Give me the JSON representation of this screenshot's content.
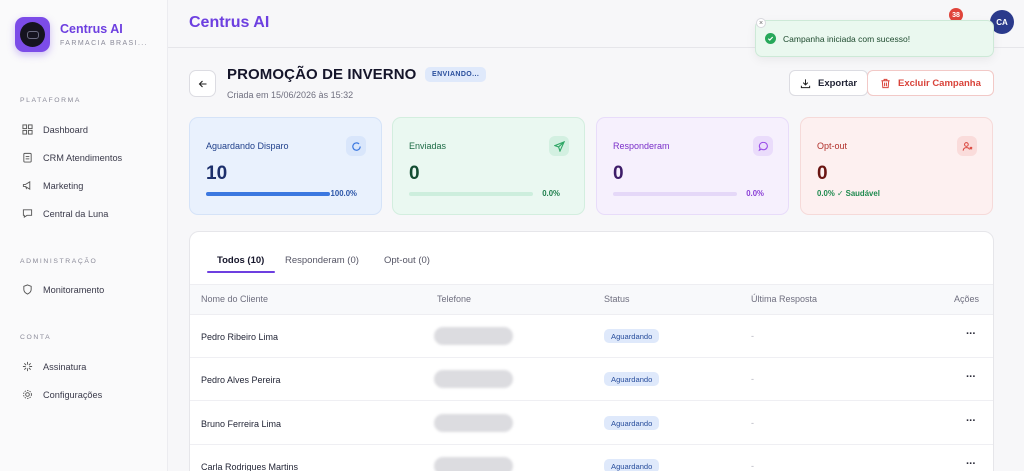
{
  "sidebar": {
    "brand_name": "Centrus AI",
    "brand_sub": "FARMACIA BRASI...",
    "sections": {
      "platform": "PLATAFORMA",
      "admin": "ADMINISTRAÇÃO",
      "account": "CONTA"
    },
    "items": {
      "dashboard": "Dashboard",
      "crm": "CRM Atendimentos",
      "marketing": "Marketing",
      "luna": "Central da Luna",
      "monitor": "Monitoramento",
      "subscription": "Assinatura",
      "settings": "Configurações"
    }
  },
  "topbar": {
    "title": "Centrus AI",
    "notification_count": "38",
    "avatar_initials": "CA"
  },
  "toast": {
    "close": "×",
    "message": "Campanha iniciada com sucesso!"
  },
  "campaign": {
    "title": "PROMOÇÃO DE INVERNO",
    "status": "ENVIANDO...",
    "created": "Criada em 15/06/2026 às 15:32",
    "export_label": "Exportar",
    "delete_label": "Excluir Campanha"
  },
  "stats": [
    {
      "label": "Aguardando Disparo",
      "value": "10",
      "percent": "100.0%",
      "fill": 1.0,
      "icon": "loading-icon"
    },
    {
      "label": "Enviadas",
      "value": "0",
      "percent": "0.0%",
      "fill": 0.0,
      "icon": "send-icon"
    },
    {
      "label": "Responderam",
      "value": "0",
      "percent": "0.0%",
      "fill": 0.0,
      "icon": "message-icon"
    },
    {
      "label": "Opt-out",
      "value": "0",
      "health": "0.0% ✓ Saudável",
      "icon": "user-remove-icon"
    }
  ],
  "tabs": [
    "Todos (10)",
    "Responderam (0)",
    "Opt-out (0)"
  ],
  "table": {
    "headers": [
      "Nome do Cliente",
      "Telefone",
      "Status",
      "Última Resposta",
      "Ações"
    ],
    "rows": [
      {
        "name": "Pedro Ribeiro Lima",
        "status": "Aguardando",
        "last": "-",
        "actions": "···"
      },
      {
        "name": "Pedro Alves Pereira",
        "status": "Aguardando",
        "last": "-",
        "actions": "···"
      },
      {
        "name": "Bruno Ferreira Lima",
        "status": "Aguardando",
        "last": "-",
        "actions": "···"
      },
      {
        "name": "Carla Rodrigues Martins",
        "status": "Aguardando",
        "last": "-",
        "actions": "···"
      }
    ]
  }
}
